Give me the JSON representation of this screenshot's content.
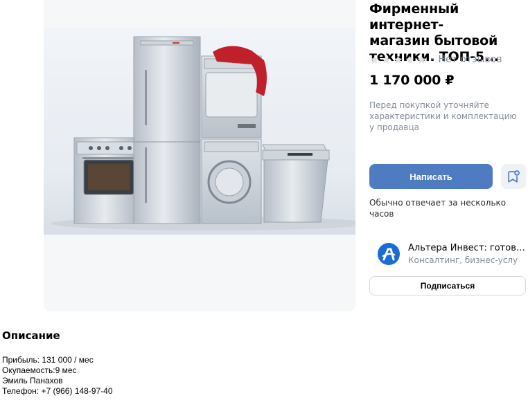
{
  "product": {
    "title": "Фирменный интернет-\nмагазин бытовой\nтехники. ТОП-5...",
    "rating": {
      "stars_filled": 0,
      "stars_total": 5,
      "separator": "·",
      "label": "Нет отзывов"
    },
    "price": "1 170 000 ₽",
    "note": "Перед покупкой уточняйте\nхарактеристики и комплектацию\nу продавца",
    "image_icon": "home-appliances-photo"
  },
  "actions": {
    "write_label": "Написать",
    "favorite_icon": "bookmark-add-icon",
    "reply_note": "Обычно отвечает за несколько\nчасов",
    "subscribe_label": "Подписаться"
  },
  "seller": {
    "name": "Альтера Инвест: готов…",
    "category": "Консалтинг, бизнес-услуги",
    "logo_letter": "А",
    "logo_color": "#1a6bd6"
  },
  "description": {
    "heading": "Описание",
    "lines": [
      "Прибыль: 131 000 / мес",
      "Окупаемость:9 мес",
      "Эмиль Панахов",
      "Телефон: +7 (966) 148-97-40"
    ]
  },
  "colors": {
    "accent": "#4f7bc1",
    "muted": "#818c99",
    "star_empty": "#e1e3e6"
  }
}
